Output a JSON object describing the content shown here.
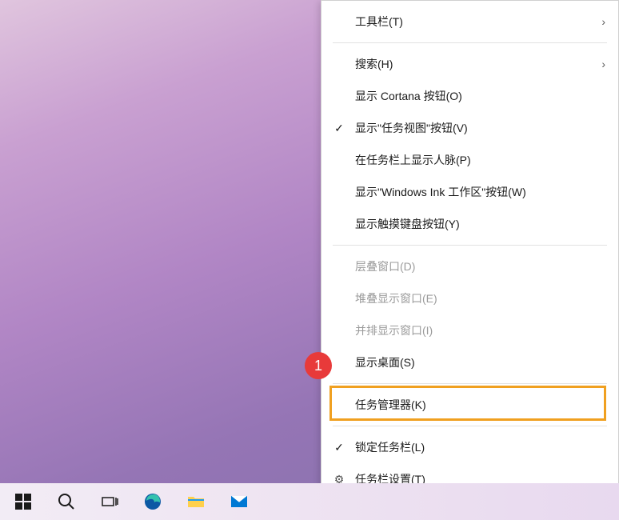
{
  "menu": {
    "items": [
      {
        "label": "工具栏(T)",
        "enabled": true,
        "check": false,
        "arrow": true,
        "gear": false
      },
      {
        "sep": true
      },
      {
        "label": "搜索(H)",
        "enabled": true,
        "check": false,
        "arrow": true,
        "gear": false
      },
      {
        "label": "显示 Cortana 按钮(O)",
        "enabled": true,
        "check": false,
        "arrow": false,
        "gear": false
      },
      {
        "label": "显示\"任务视图\"按钮(V)",
        "enabled": true,
        "check": true,
        "arrow": false,
        "gear": false
      },
      {
        "label": "在任务栏上显示人脉(P)",
        "enabled": true,
        "check": false,
        "arrow": false,
        "gear": false
      },
      {
        "label": "显示\"Windows Ink 工作区\"按钮(W)",
        "enabled": true,
        "check": false,
        "arrow": false,
        "gear": false
      },
      {
        "label": "显示触摸键盘按钮(Y)",
        "enabled": true,
        "check": false,
        "arrow": false,
        "gear": false
      },
      {
        "sep": true
      },
      {
        "label": "层叠窗口(D)",
        "enabled": false,
        "check": false,
        "arrow": false,
        "gear": false
      },
      {
        "label": "堆叠显示窗口(E)",
        "enabled": false,
        "check": false,
        "arrow": false,
        "gear": false
      },
      {
        "label": "并排显示窗口(I)",
        "enabled": false,
        "check": false,
        "arrow": false,
        "gear": false
      },
      {
        "label": "显示桌面(S)",
        "enabled": true,
        "check": false,
        "arrow": false,
        "gear": false
      },
      {
        "sep": true
      },
      {
        "label": "任务管理器(K)",
        "enabled": true,
        "check": false,
        "arrow": false,
        "gear": false
      },
      {
        "sep": true
      },
      {
        "label": "锁定任务栏(L)",
        "enabled": true,
        "check": true,
        "arrow": false,
        "gear": false
      },
      {
        "label": "任务栏设置(T)",
        "enabled": true,
        "check": false,
        "arrow": false,
        "gear": true
      }
    ]
  },
  "annotation": {
    "badge": "1"
  },
  "taskbar": {
    "start": "start-icon",
    "search": "search-icon",
    "taskview": "task-view-icon",
    "edge": "edge-icon",
    "explorer": "file-explorer-icon",
    "mail": "mail-icon"
  },
  "icons": {
    "check": "✓",
    "chevron": "›",
    "gear": "⚙"
  }
}
